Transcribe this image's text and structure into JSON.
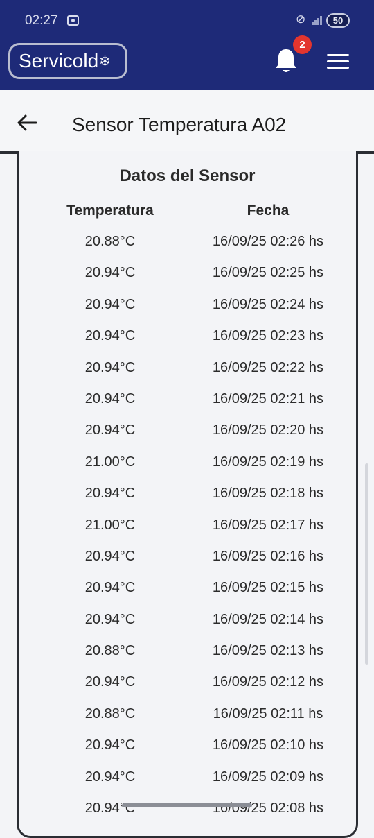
{
  "status_bar": {
    "time": "02:27",
    "battery": "50",
    "mute_icon": "vibrate-off-icon",
    "signal_icon": "signal-icon",
    "record_icon": "screen-record-icon"
  },
  "header": {
    "logo_text": "Servicold",
    "logo_icon": "snowflake-icon",
    "notification_count": "2",
    "bell_icon": "bell-icon",
    "menu_icon": "hamburger-menu-icon",
    "colors": {
      "background": "#1e2a78",
      "badge": "#e3352e"
    }
  },
  "page": {
    "title": "Sensor Temperatura A02",
    "back_icon": "arrow-left-icon"
  },
  "sensor": {
    "title": "Datos del Sensor",
    "columns": {
      "temperature": "Temperatura",
      "date": "Fecha"
    },
    "rows": [
      {
        "temp": "20.88°C",
        "date": "16/09/25 02:26 hs"
      },
      {
        "temp": "20.94°C",
        "date": "16/09/25 02:25 hs"
      },
      {
        "temp": "20.94°C",
        "date": "16/09/25 02:24 hs"
      },
      {
        "temp": "20.94°C",
        "date": "16/09/25 02:23 hs"
      },
      {
        "temp": "20.94°C",
        "date": "16/09/25 02:22 hs"
      },
      {
        "temp": "20.94°C",
        "date": "16/09/25 02:21 hs"
      },
      {
        "temp": "20.94°C",
        "date": "16/09/25 02:20 hs"
      },
      {
        "temp": "21.00°C",
        "date": "16/09/25 02:19 hs"
      },
      {
        "temp": "20.94°C",
        "date": "16/09/25 02:18 hs"
      },
      {
        "temp": "21.00°C",
        "date": "16/09/25 02:17 hs"
      },
      {
        "temp": "20.94°C",
        "date": "16/09/25 02:16 hs"
      },
      {
        "temp": "20.94°C",
        "date": "16/09/25 02:15 hs"
      },
      {
        "temp": "20.94°C",
        "date": "16/09/25 02:14 hs"
      },
      {
        "temp": "20.88°C",
        "date": "16/09/25 02:13 hs"
      },
      {
        "temp": "20.94°C",
        "date": "16/09/25 02:12 hs"
      },
      {
        "temp": "20.88°C",
        "date": "16/09/25 02:11 hs"
      },
      {
        "temp": "20.94°C",
        "date": "16/09/25 02:10 hs"
      },
      {
        "temp": "20.94°C",
        "date": "16/09/25 02:09 hs"
      },
      {
        "temp": "20.94°C",
        "date": "16/09/25 02:08 hs"
      }
    ]
  }
}
